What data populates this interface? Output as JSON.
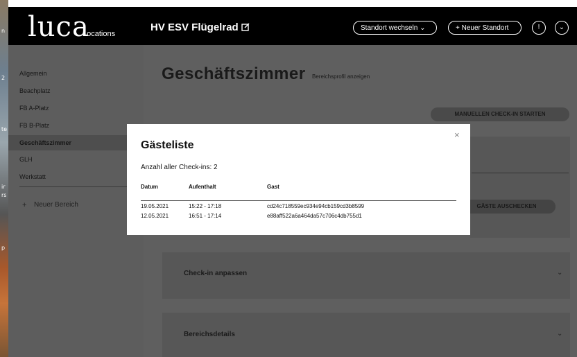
{
  "desktop": {
    "strip_marks": [
      "n",
      "2",
      "te",
      "ir",
      "rs",
      "p"
    ]
  },
  "header": {
    "logo": "luca",
    "logo_sub": "Locations",
    "location_name": "HV ESV Flügelrad",
    "switch_location": "Standort wechseln",
    "new_location": "+ Neuer Standort",
    "info_icon": "!",
    "dropdown_icon": "⌄"
  },
  "sidebar": {
    "items": [
      "Allgemein",
      "Beachplatz",
      "FB A-Platz",
      "FB B-Platz",
      "Geschäftszimmer",
      "GLH",
      "Werkstatt"
    ],
    "active_index": 4,
    "new_area": "Neuer Bereich"
  },
  "main": {
    "title": "Geschäftszimmer",
    "profile_link": "Bereichsprofil anzeigen",
    "manual_checkin": "MANUELLEN CHECK-IN STARTEN",
    "checkout_guests": "GÄSTE AUSCHECKEN",
    "section_checkin": "Check-in anpassen",
    "section_details": "Bereichsdetails"
  },
  "modal": {
    "title": "Gästeliste",
    "count_label": "Anzahl aller Check-ins: 2",
    "close": "×",
    "columns": [
      "Datum",
      "Aufenthalt",
      "Gast"
    ],
    "rows": [
      {
        "date": "19.05.2021",
        "stay": "15:22 - 17:18",
        "guest": "cd24c718559ec934e94cb159cd3b8599"
      },
      {
        "date": "12.05.2021",
        "stay": "16:51 - 17:14",
        "guest": "e88aff522a6a464da57c706c4db755d1"
      }
    ]
  },
  "colors": {
    "header_bg": "#000000",
    "overlay_gray": "#5f5f5f",
    "modal_bg": "#ffffff"
  }
}
